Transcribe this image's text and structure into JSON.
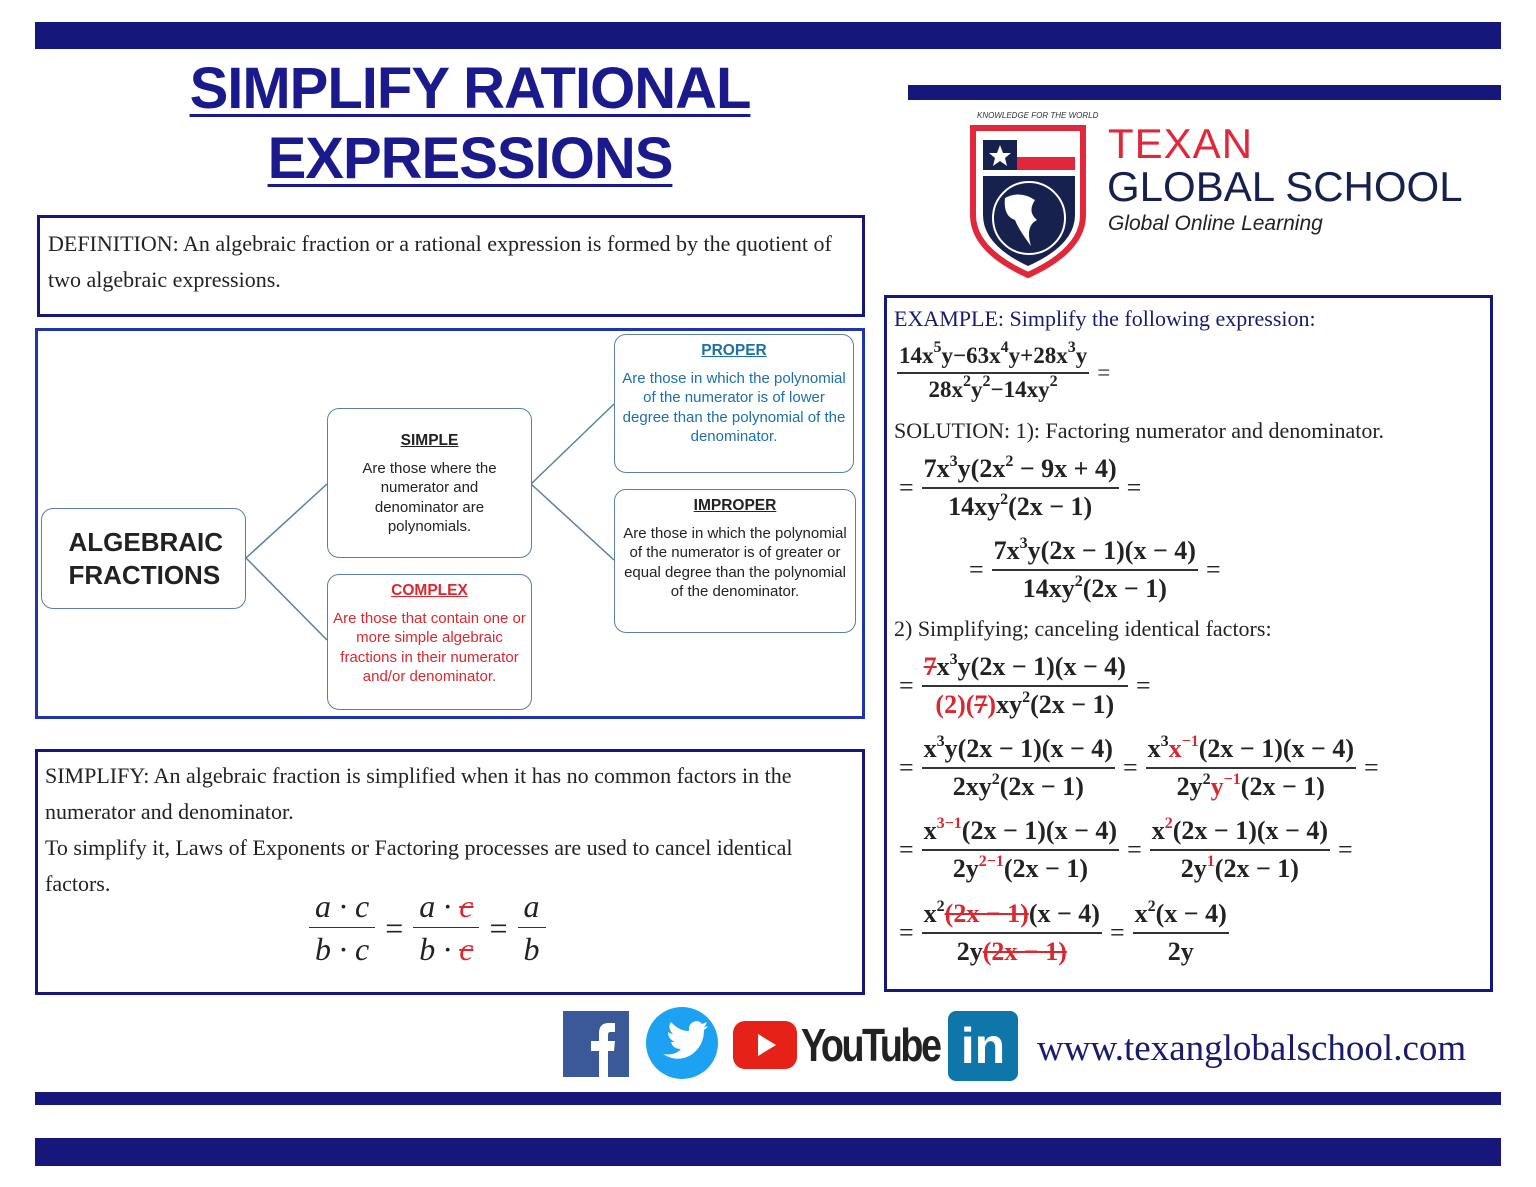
{
  "title": {
    "line1": "SIMPLIFY RATIONAL",
    "line2": "EXPRESSIONS"
  },
  "colors": {
    "navy": "#16177a",
    "red": "#d9282f",
    "blue": "#1f6fa8"
  },
  "logo": {
    "tagline": "KNOWLEDGE FOR THE WORLD",
    "name1": "TEXAN",
    "name2": "GLOBAL SCHOOL",
    "sub": "Global Online Learning"
  },
  "definition": {
    "text": "DEFINITION: An algebraic fraction or a rational expression is formed by the quotient of two algebraic expressions."
  },
  "diagram": {
    "root": "ALGEBRAIC FRACTIONS",
    "simple": {
      "title": "SIMPLE",
      "text": "Are those where the numerator and denominator are polynomials."
    },
    "complex": {
      "title": "COMPLEX",
      "text": "Are those that contain one or more simple algebraic fractions in their numerator and/or denominator."
    },
    "proper": {
      "title": "PROPER",
      "text": "Are those in which the polynomial of the numerator is of lower degree than the polynomial of the denominator."
    },
    "improper": {
      "title": "IMPROPER",
      "text": "Are those in which the polynomial of the numerator is of greater or equal degree than the polynomial of the denominator."
    }
  },
  "simplify": {
    "text1": "SIMPLIFY: An algebraic fraction is simplified when it has no common factors in the numerator and denominator.",
    "text2": "To simplify it, Laws of Exponents or Factoring processes are used to cancel identical factors.",
    "formula": [
      {
        "frac": [
          "a · c",
          "b · c"
        ]
      },
      {
        "op": "="
      },
      {
        "frac": [
          "a · {s:c}",
          "b · {s:c}"
        ]
      },
      {
        "op": "="
      },
      {
        "frac": [
          "a",
          "b"
        ]
      }
    ]
  },
  "example": {
    "label": "EXAMPLE:",
    "prompt": "Simplify the following expression:",
    "solution_label": "SOLUTION:",
    "step1": "1): Factoring numerator and denominator.",
    "step2": "2) Simplifying; canceling identical factors:",
    "rows": [
      [
        {
          "frac": [
            "14x^{5}y−63x^{4}y+28x^{3}y",
            "28x^{2}y^{2}−14xy^{2}"
          ]
        },
        {
          "op": "="
        }
      ],
      [
        {
          "op": "="
        },
        {
          "frac": [
            "7x^{3}y(2x^{2} − 9x + 4)",
            "14xy^{2}(2x − 1)"
          ]
        },
        {
          "op": "="
        }
      ],
      [
        {
          "op": "="
        },
        {
          "frac": [
            "7x^{3}y(2x − 1)(x − 4)",
            "14xy^{2}(2x − 1)"
          ]
        },
        {
          "op": "="
        }
      ],
      [
        {
          "op": "="
        },
        {
          "frac": [
            "{s:7}x^{3}y(2x − 1)(x − 4)",
            "{r:(2)(}{s:7}{r:)}xy^{2}(2x − 1)"
          ]
        },
        {
          "op": "="
        }
      ],
      [
        {
          "op": "="
        },
        {
          "frac": [
            "x^{3}y(2x − 1)(x − 4)",
            "2xy^{2}(2x − 1)"
          ]
        },
        {
          "op": "="
        },
        {
          "frac": [
            "x^{3}{r:x}^{r:−1}(2x − 1)(x − 4)",
            "2y^{2}{r:y}^{r:−1}(2x − 1)"
          ]
        },
        {
          "op": "="
        }
      ],
      [
        {
          "op": "="
        },
        {
          "frac": [
            "x^{r:3−1}(2x − 1)(x − 4)",
            "2y^{r:2−1}(2x − 1)"
          ]
        },
        {
          "op": "="
        },
        {
          "frac": [
            "x^{r:2}(2x − 1)(x − 4)",
            "2y^{r:1}(2x − 1)"
          ]
        },
        {
          "op": "="
        }
      ],
      [
        {
          "op": "="
        },
        {
          "frac": [
            "x^{2}{s:(2x − 1)}(x − 4)",
            "2y{s:(2x − 1)}"
          ]
        },
        {
          "op": "="
        },
        {
          "frac": [
            "x^{2}(x − 4)",
            "2y"
          ]
        }
      ]
    ]
  },
  "footer": {
    "youtube": "YouTube",
    "linkedin": "in",
    "url": "www.texanglobalschool.com"
  }
}
